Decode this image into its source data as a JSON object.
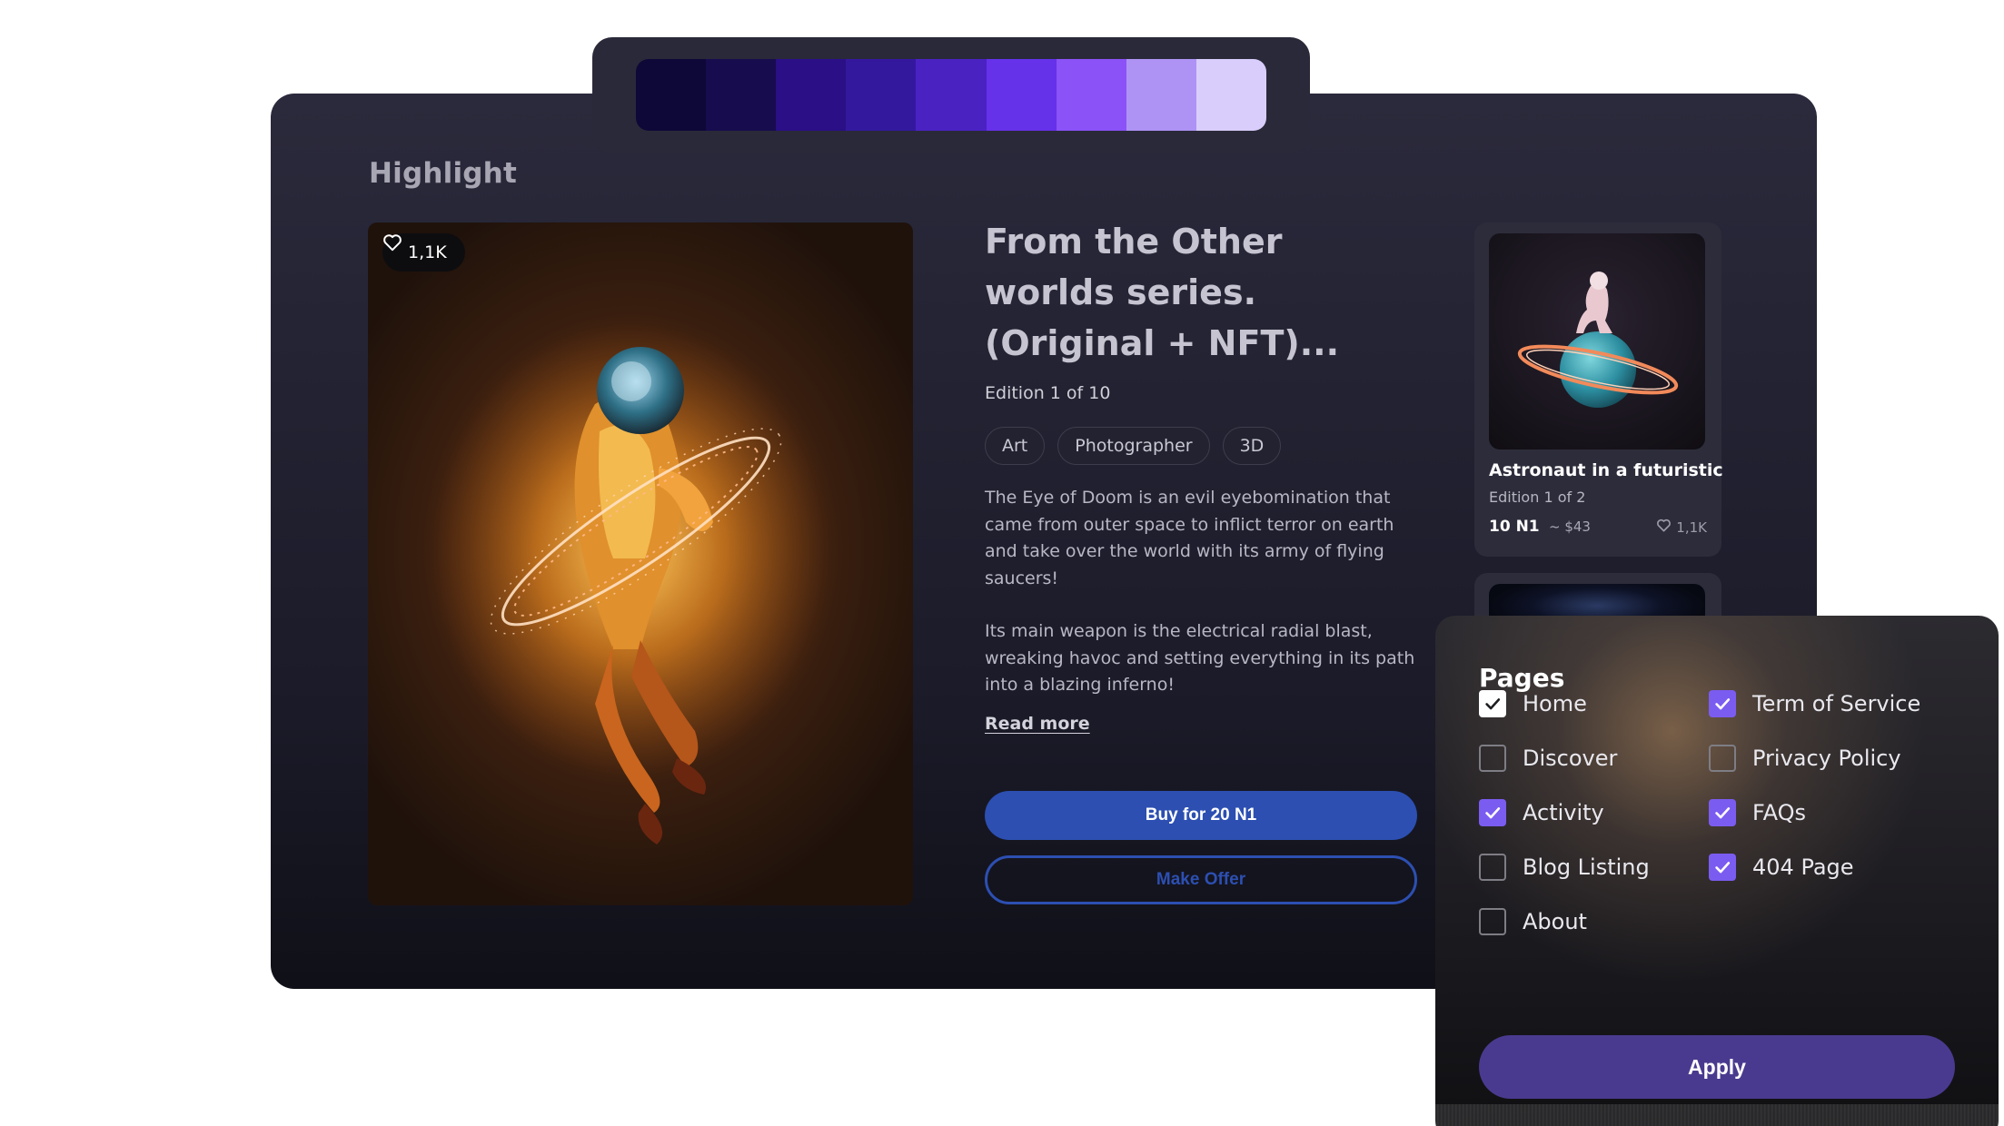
{
  "palette": {
    "colors": [
      "#0e0838",
      "#170c4e",
      "#2a0f86",
      "#33189d",
      "#4a22c2",
      "#6531e9",
      "#8a52f7",
      "#ae93f5",
      "#d8cdfb"
    ]
  },
  "highlight": {
    "section_title": "Highlight",
    "hero": {
      "likes": "1,1K",
      "like_icon": "heart-outline-icon"
    },
    "title": "From the Other worlds series. (Original + NFT)...",
    "edition": "Edition 1 of 10",
    "tags": [
      "Art",
      "Photographer",
      "3D"
    ],
    "description": [
      "The Eye of Doom is an evil eyebomination that came from outer space to inflict terror on earth and take over the world with its army of flying saucers!",
      "Its main weapon is the electrical radial blast, wreaking havoc and setting everything in its path into a blazing inferno!"
    ],
    "read_more": "Read more",
    "buy_button": "Buy for 20 N1",
    "offer_button": "Make Offer",
    "accent": "#2c4fb1"
  },
  "side_card": {
    "title": "Astronaut in a futuristic",
    "edition": "Edition 1 of 2",
    "price": "10 N1",
    "usd": "~ $43",
    "likes": "1,1K"
  },
  "pages_filter": {
    "title": "Pages",
    "left_column": [
      {
        "label": "Home",
        "checked": true,
        "style": "white"
      },
      {
        "label": "Discover",
        "checked": false
      },
      {
        "label": "Activity",
        "checked": true,
        "style": "purple"
      },
      {
        "label": "Blog Listing",
        "checked": false
      },
      {
        "label": "About",
        "checked": false
      }
    ],
    "right_column": [
      {
        "label": "Term of Service",
        "checked": true,
        "style": "purple"
      },
      {
        "label": "Privacy Policy",
        "checked": false
      },
      {
        "label": "FAQs",
        "checked": true,
        "style": "purple"
      },
      {
        "label": "404 Page",
        "checked": true,
        "style": "purple"
      }
    ],
    "apply_button": "Apply",
    "check_color": "#7b5cf0"
  }
}
